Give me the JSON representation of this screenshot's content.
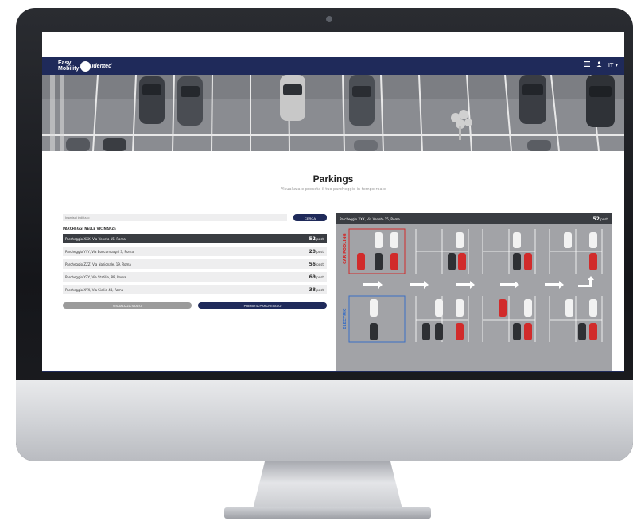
{
  "navbar": {
    "logo_line1": "Easy",
    "logo_line2": "Mobility",
    "logo_brand": "Idented",
    "lang": "IT"
  },
  "page": {
    "title": "Parkings",
    "subtitle": "Visualizza e prenota il tuo parcheggio in tempo reale"
  },
  "search": {
    "placeholder": "Inserisci indirizzo",
    "button_label": "CERCA"
  },
  "list": {
    "header": "PARCHEGGI NELLE VICINANZE",
    "items": [
      {
        "name": "Parcheggio XXX, Via Veneto 15, Roma",
        "count": "52",
        "unit": "posti"
      },
      {
        "name": "Parcheggio YYY, Via Boncompagni 3, Roma",
        "count": "28",
        "unit": "posti"
      },
      {
        "name": "Parcheggio ZZZ, Via Nazionale, 19, Roma",
        "count": "56",
        "unit": "posti"
      },
      {
        "name": "Parcheggio YZY, Via Statilia, 89, Roma",
        "count": "69",
        "unit": "posti"
      },
      {
        "name": "Parcheggio XYX, Via Sicilia 48, Roma",
        "count": "38",
        "unit": "posti"
      }
    ]
  },
  "buttons": {
    "view_state": "VISUALIZZA STATO",
    "book": "PRENOTA PARCHEGGIO"
  },
  "map": {
    "title": "Parcheggio XXX, Via Veneto 15, Roma",
    "count": "52",
    "unit": "posti",
    "label_car_pooling": "CAR POOLING",
    "label_electric": "ELECTRIC"
  },
  "colors": {
    "brand_navy": "#1f2a5a",
    "accent_red": "#d12b2b",
    "accent_blue": "#3b6fc4"
  }
}
